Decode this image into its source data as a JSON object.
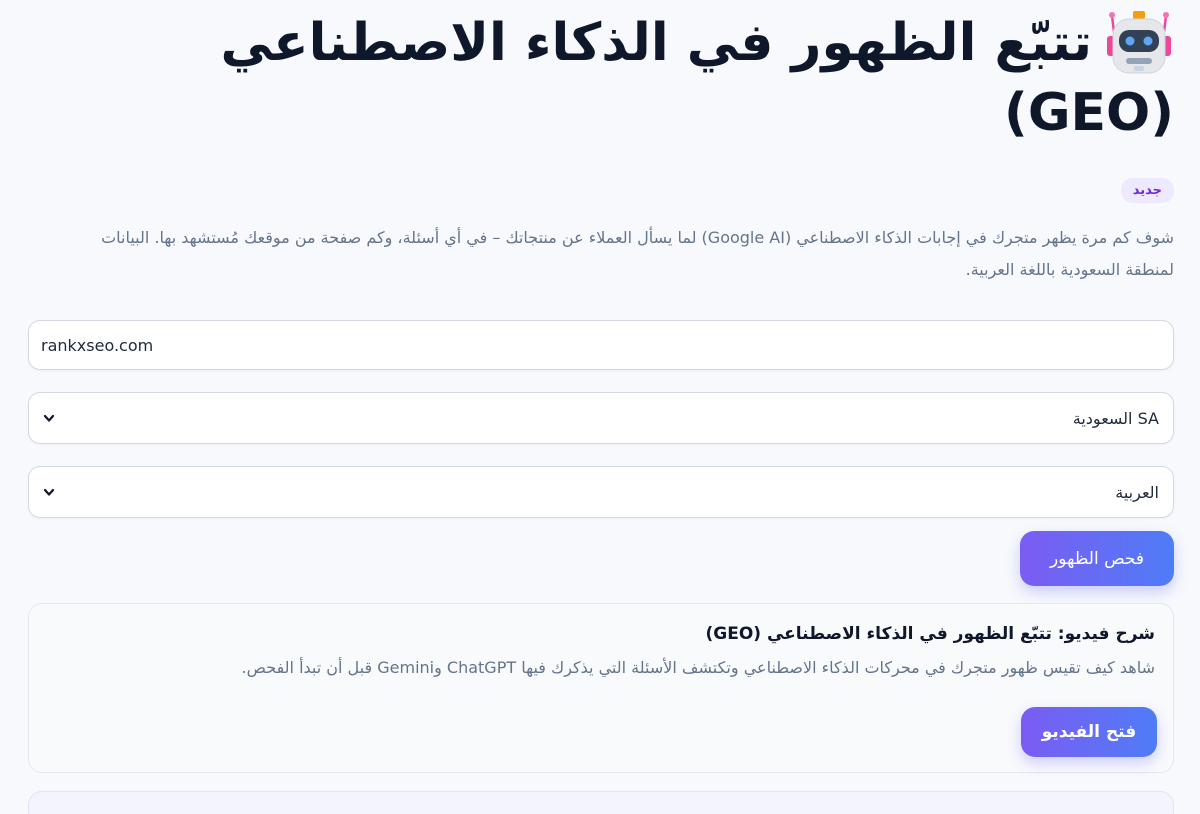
{
  "header": {
    "title": "تتبّع الظهور في الذكاء الاصطناعي",
    "title_suffix": "(GEO)",
    "robot_icon": "robot-icon",
    "badge": "جديد"
  },
  "description": "شوف كم مرة يظهر متجرك في إجابات الذكاء الاصطناعي (Google AI) لما يسأل العملاء عن منتجاتك – في أي أسئلة، وكم صفحة من موقعك مُستشهد بها. البيانات لمنطقة السعودية باللغة العربية.",
  "form": {
    "domain_value": "rankxseo.com",
    "country_selected": "SA السعودية",
    "language_selected": "العربية",
    "check_button": "فحص الظهور"
  },
  "video_card": {
    "title": "شرح فيديو: تتبّع الظهور في الذكاء الاصطناعي (GEO)",
    "description": "شاهد كيف تقيس ظهور متجرك في محركات الذكاء الاصطناعي وتكتشف الأسئلة التي يذكرك فيها ChatGPT وGemini قبل أن تبدأ الفحص.",
    "button": "فتح الفيديو"
  },
  "colors": {
    "accent_start": "#7b5cf2",
    "accent_end": "#4f7cf7",
    "badge_bg": "#ede9fe",
    "badge_text": "#6d28d9"
  }
}
